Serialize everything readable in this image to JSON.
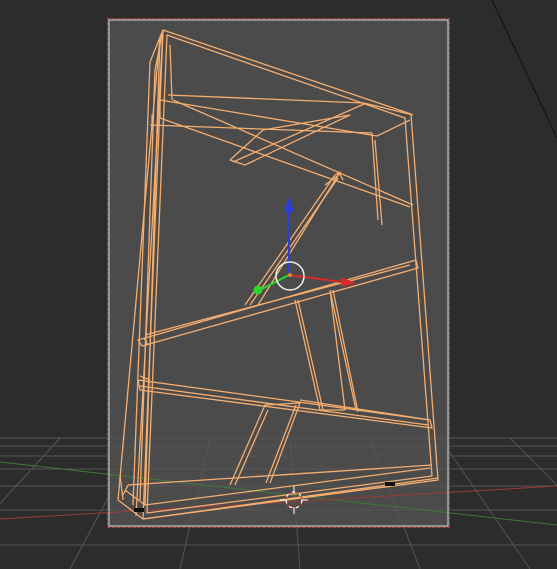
{
  "viewport": {
    "background": "#393939",
    "outer_background": "#2a2a2a",
    "camera_frame_fill": "#4a4a4a",
    "camera_frame_border": "#d9d9d9",
    "passepartout_dash": "#c0392b",
    "grid_color": "#4e4e4e",
    "x_axis_color": "#b84848",
    "y_axis_color": "#4b8b3b",
    "wire_color": "#f7b173",
    "wire_highlight": "#ffd8b0"
  },
  "gizmo": {
    "z_color": "#2a3fd8",
    "x_color": "#d82a2a",
    "y_color": "#2ad82a",
    "pivot_color": "#f0f0f0",
    "icons": [
      "arrow-up-icon",
      "arrow-right-icon",
      "dot-icon",
      "circle-icon"
    ]
  },
  "cursor_3d": {
    "icon": "crosshair-icon",
    "colors": [
      "#ffffff",
      "#c0392b"
    ]
  }
}
